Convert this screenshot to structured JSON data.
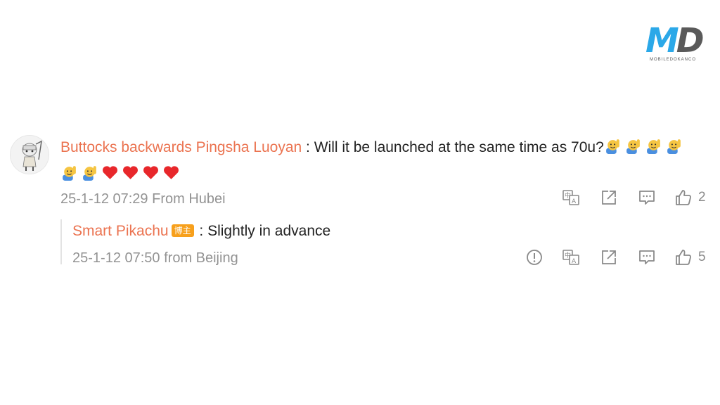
{
  "watermark": {
    "letter_m": "M",
    "letter_d": "D",
    "subtitle": "MOBILEDOKANCO"
  },
  "comment": {
    "username": "Buttocks backwards Pingsha Luoyan",
    "separator": " : ",
    "text": "Will it be launched at the same time as 70u?",
    "inline_emojis": [
      "raising-hand-emoji",
      "raising-hand-emoji",
      "raising-hand-emoji",
      "raising-hand-emoji"
    ],
    "second_row_emojis": [
      "raising-hand-emoji",
      "raising-hand-emoji",
      "heart-emoji",
      "heart-emoji",
      "heart-emoji",
      "heart-emoji"
    ],
    "timestamp": "25-1-12 07:29 From Hubei",
    "like_count": "2",
    "action_icons": [
      "translate-icon",
      "share-icon",
      "comment-icon",
      "thumbs-up-icon"
    ]
  },
  "reply": {
    "username": "Smart Pikachu",
    "badge": "博主",
    "separator": " : ",
    "text": "Slightly in advance",
    "timestamp": "25-1-12 07:50 from Beijing",
    "like_count": "5",
    "action_icons": [
      "report-icon",
      "translate-icon",
      "share-icon",
      "comment-icon",
      "thumbs-up-icon"
    ]
  },
  "colors": {
    "username": "#eb7350",
    "meta": "#939393",
    "badge": "#f7a01c",
    "logo_blue": "#2ba8e8",
    "logo_gray": "#5a5a5a"
  }
}
